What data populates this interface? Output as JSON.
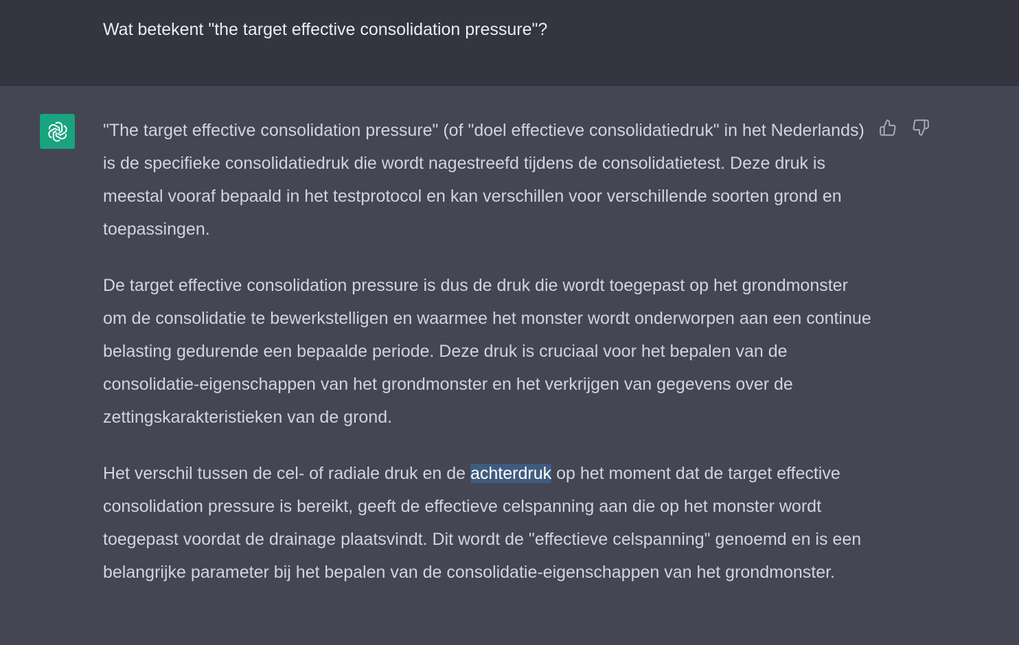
{
  "user_message": {
    "text": "Wat betekent \"the target effective consolidation pressure\"?"
  },
  "assistant_message": {
    "avatar_icon": "openai-logo-icon",
    "accent_color": "#19a37f",
    "paragraphs": [
      "\"The target effective consolidation pressure\" (of \"doel effectieve consolidatiedruk\" in het Nederlands) is de specifieke consolidatiedruk die wordt nagestreefd tijdens de consolidatietest. Deze druk is meestal vooraf bepaald in het testprotocol en kan verschillen voor verschillende soorten grond en toepassingen.",
      "De target effective consolidation pressure is dus de druk die wordt toegepast op het grondmonster om de consolidatie te bewerkstelligen en waarmee het monster wordt onderworpen aan een continue belasting gedurende een bepaalde periode. Deze druk is cruciaal voor het bepalen van de consolidatie-eigenschappen van het grondmonster en het verkrijgen van gegevens over de zettingskarakteristieken van de grond."
    ],
    "paragraph3": {
      "before": "Het verschil tussen de cel- of radiale druk en de ",
      "highlighted": "achterdruk",
      "after": " op het moment dat de target effective consolidation pressure is bereikt, geeft de effectieve celspanning aan die op het monster wordt toegepast voordat de drainage plaatsvindt. Dit wordt de \"effectieve celspanning\" genoemd en is een belangrijke parameter bij het bepalen van de consolidatie-eigenschappen van het grondmonster."
    },
    "feedback": {
      "thumbs_up_icon": "thumbs-up-icon",
      "thumbs_down_icon": "thumbs-down-icon"
    }
  }
}
